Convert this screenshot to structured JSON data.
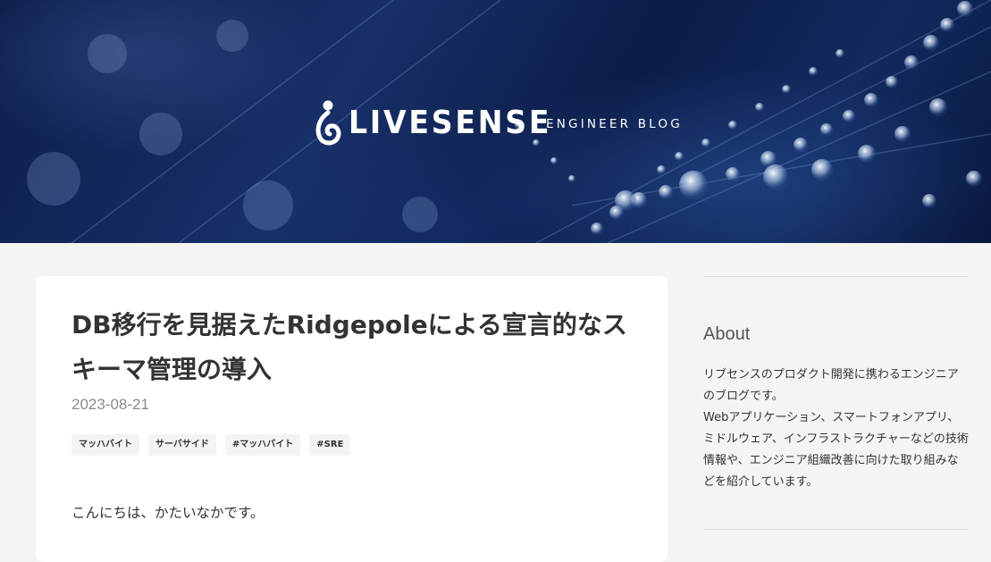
{
  "header": {
    "brand_name": "LIVESENSE",
    "tagline": "ENGINEER BLOG",
    "logo_icon": "livesense-hook-logo"
  },
  "article": {
    "title": "DB移行を見据えたRidgepoleによる宣言的なスキーマ管理の導入",
    "date": "2023-08-21",
    "tags": [
      "マッハバイト",
      "サーバサイド",
      "#マッハバイト",
      "#SRE"
    ],
    "first_paragraph": "こんにちは、かたいなかです。"
  },
  "sidebar": {
    "about_title": "About",
    "about_text": "リブセンスのプロダクト開発に携わるエンジニアのブログです。\nWebアプリケーション、スマートフォンアプリ、ミドルウェア、インフラストラクチャーなどの技術情報や、エンジニア組織改善に向けた取り組みなどを紹介しています。"
  }
}
